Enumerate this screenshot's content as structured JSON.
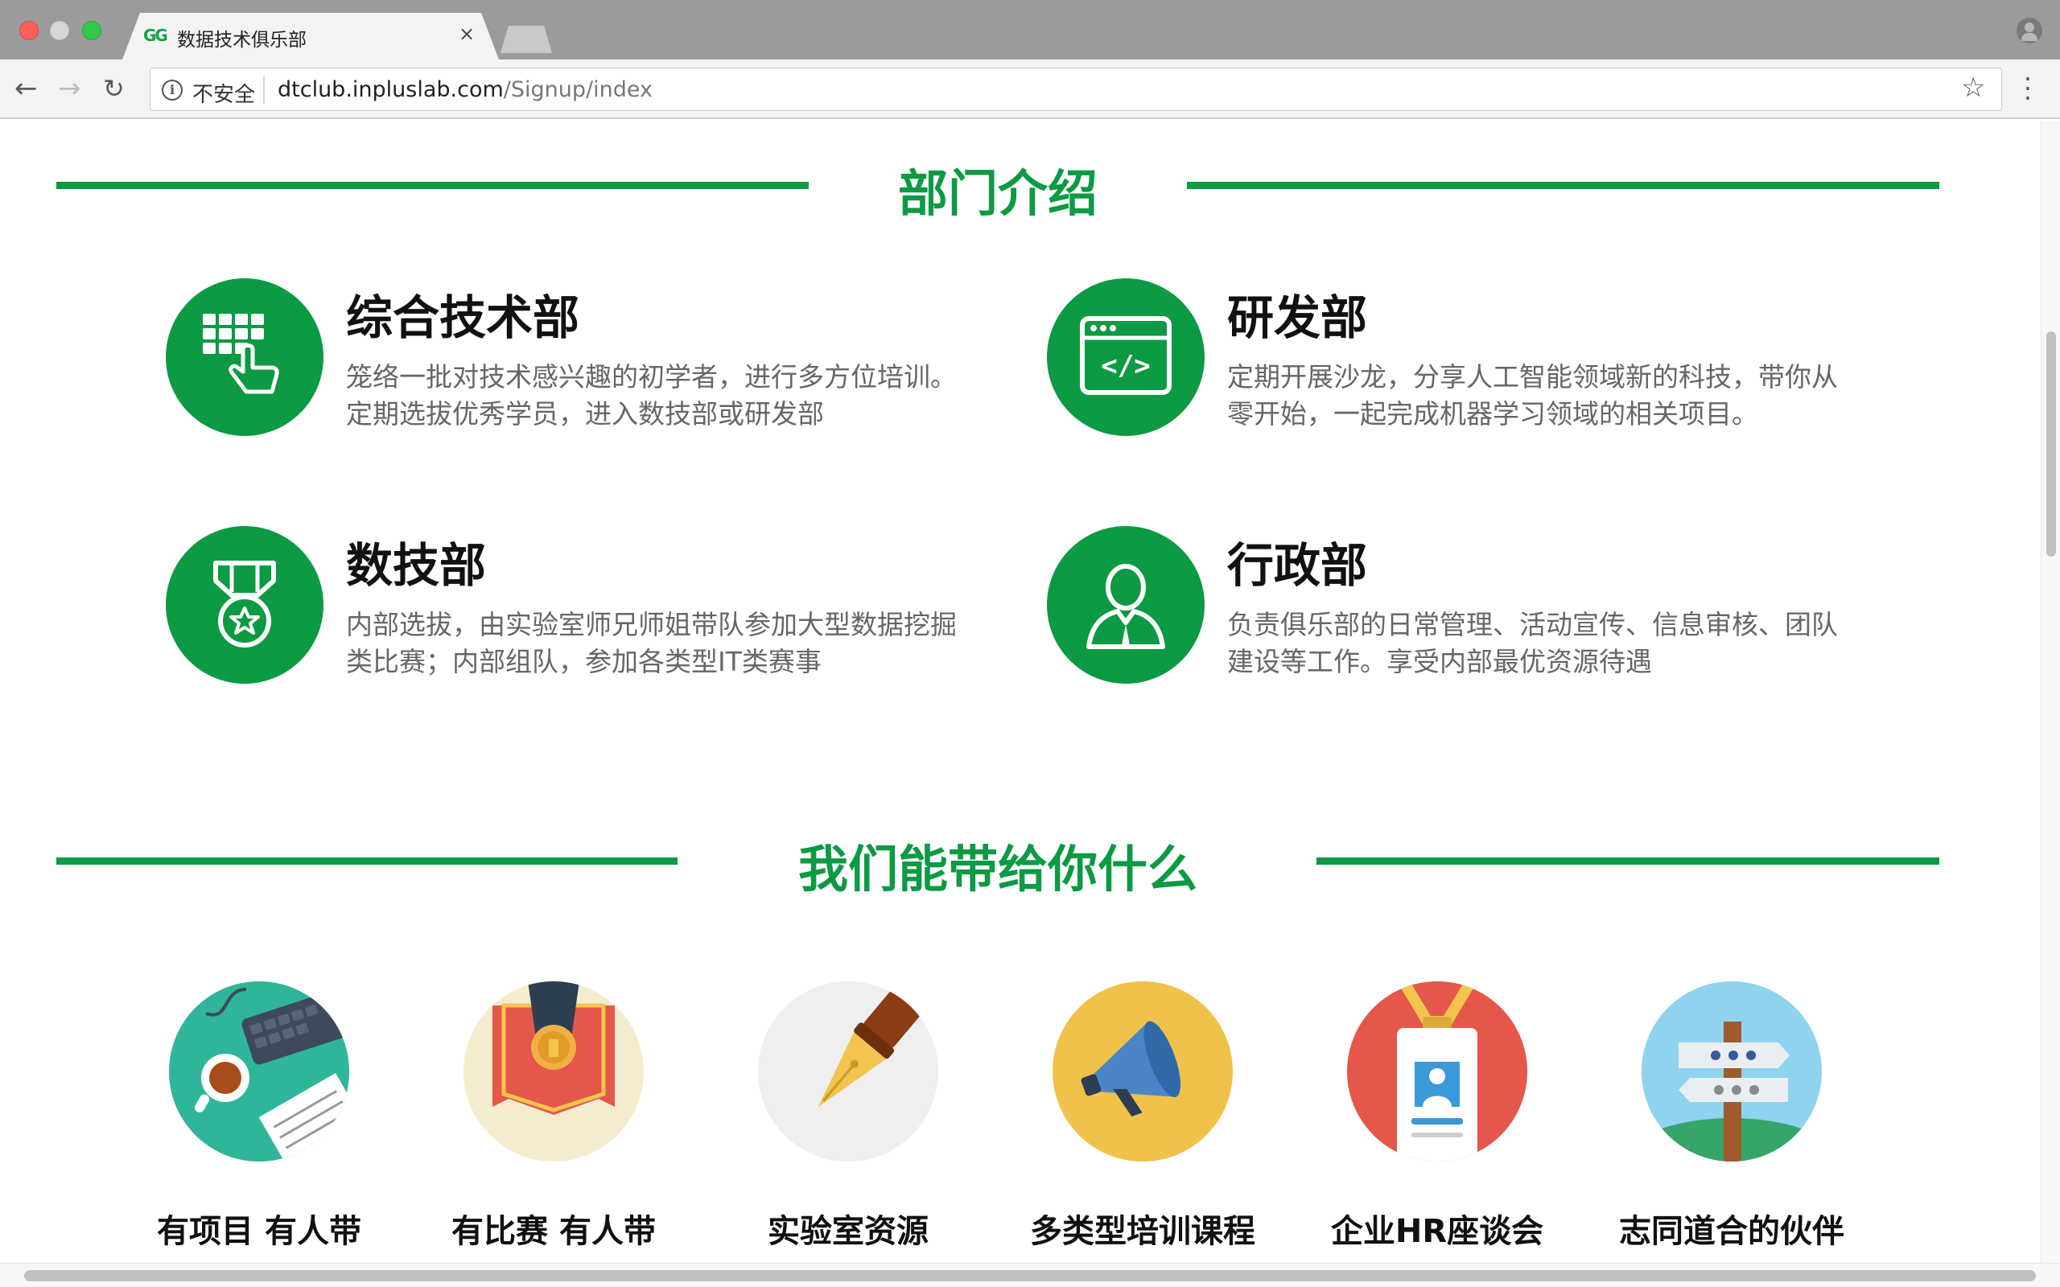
{
  "browser": {
    "tab_title": "数据技术俱乐部",
    "tab_favicon": "GG",
    "tab_close": "×",
    "security_label": "不安全",
    "url_host": "dtclub.inpluslab.com",
    "url_path": "/Signup/index",
    "icons": [
      "back-arrow-icon",
      "forward-arrow-icon",
      "reload-icon",
      "info-icon",
      "star-icon",
      "menu-dots-icon",
      "profile-icon"
    ]
  },
  "section_departments": {
    "title": "部门介绍",
    "items": [
      {
        "name": "综合技术部",
        "desc": "笼络一批对技术感兴趣的初学者，进行多方位培训。定期选拔优秀学员，进入数技部或研发部",
        "icon": "keypad-hand-icon"
      },
      {
        "name": "研发部",
        "desc": "定期开展沙龙，分享人工智能领域新的科技，带你从零开始，一起完成机器学习领域的相关项目。",
        "icon": "code-window-icon"
      },
      {
        "name": "数技部",
        "desc": "内部选拔，由实验室师兄师姐带队参加大型数据挖掘类比赛；内部组队，参加各类型IT类赛事",
        "icon": "medal-icon"
      },
      {
        "name": "行政部",
        "desc": "负责俱乐部的日常管理、活动宣传、信息审核、团队建设等工作。享受内部最优资源待遇",
        "icon": "person-icon"
      }
    ]
  },
  "section_benefits": {
    "title": "我们能带给你什么",
    "items": [
      {
        "label": "有项目 有人带",
        "icon": "desk-keyboard-coffee-icon",
        "bg": "#2fb59a"
      },
      {
        "label": "有比赛 有人带",
        "icon": "medal-ribbon-icon",
        "bg": "#f5ecd0"
      },
      {
        "label": "实验室资源",
        "icon": "fountain-pen-icon",
        "bg": "#efefef"
      },
      {
        "label": "多类型培训课程",
        "icon": "megaphone-icon",
        "bg": "#f0c24b"
      },
      {
        "label": "企业HR座谈会",
        "icon": "id-badge-icon",
        "bg": "#e4574a"
      },
      {
        "label": "志同道合的伙伴",
        "icon": "signpost-icon",
        "bg": "#8fd3ef"
      }
    ]
  },
  "colors": {
    "accent": "#0c9a43",
    "heading": "#111111",
    "body_text": "#666666"
  }
}
